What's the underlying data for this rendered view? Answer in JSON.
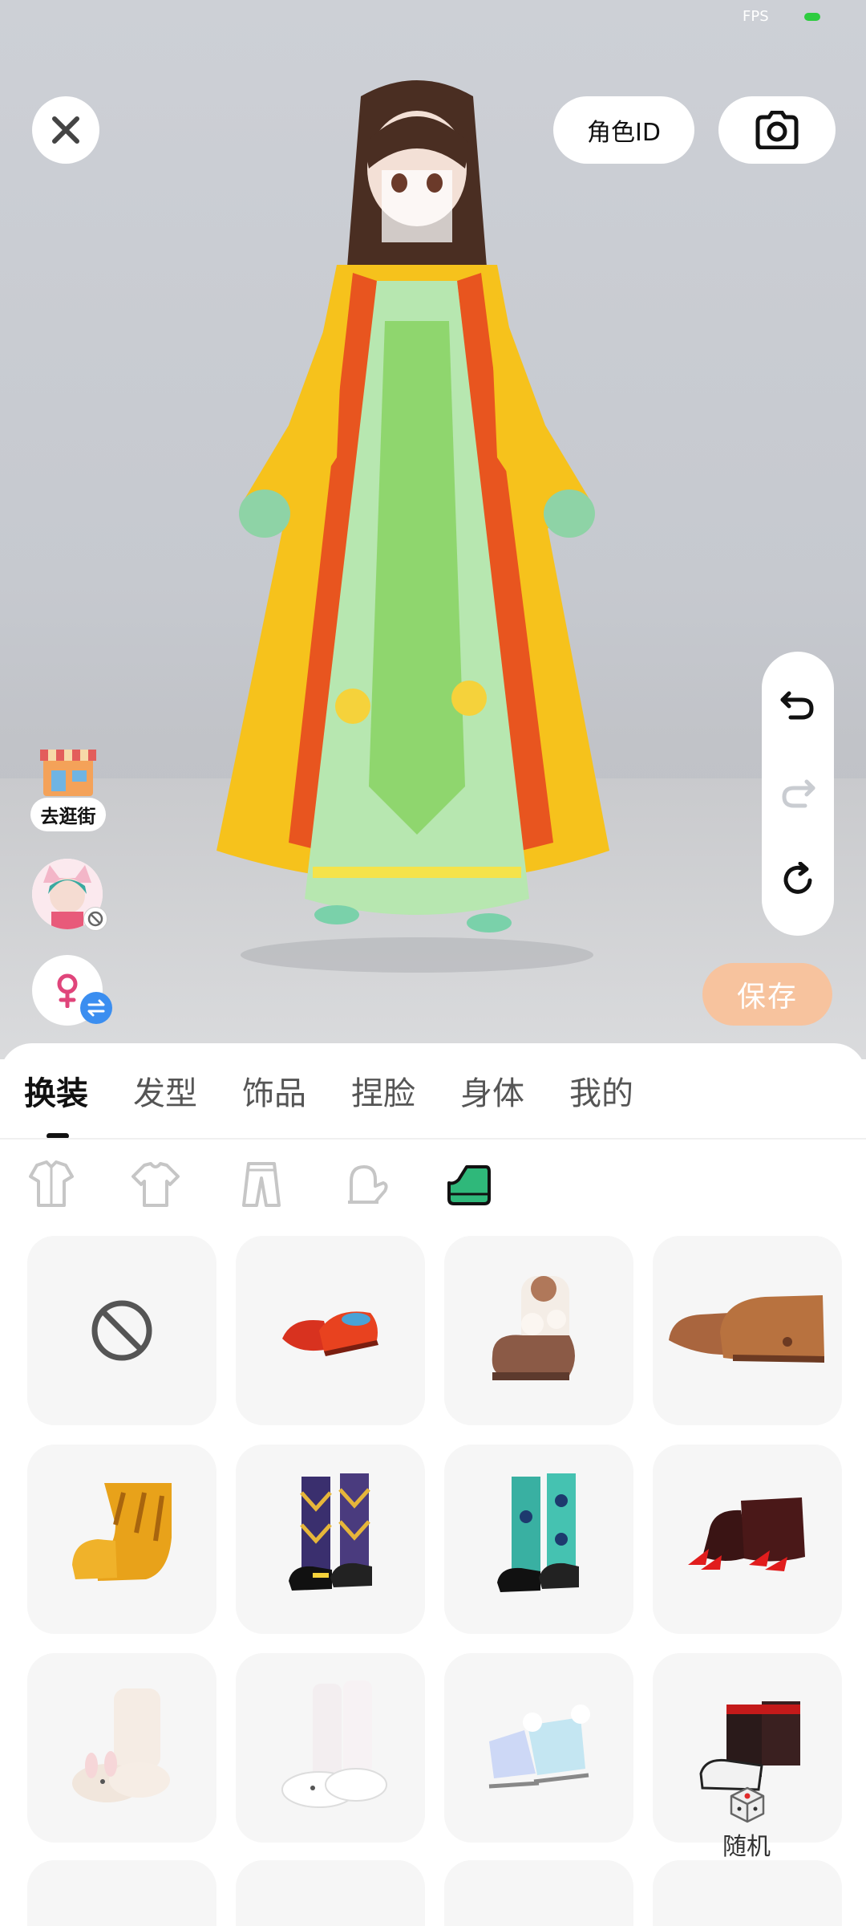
{
  "status": {
    "fps_label": "FPS"
  },
  "topbar": {
    "role_id_label": "角色ID"
  },
  "side": {
    "shop_label": "去逛街"
  },
  "actions": {
    "save_label": "保存"
  },
  "tabs": [
    {
      "label": "换装",
      "active": true
    },
    {
      "label": "发型",
      "active": false
    },
    {
      "label": "饰品",
      "active": false
    },
    {
      "label": "捏脸",
      "active": false
    },
    {
      "label": "身体",
      "active": false
    },
    {
      "label": "我的",
      "active": false
    }
  ],
  "subcategories": [
    "outfit-icon",
    "top-icon",
    "pants-icon",
    "glove-icon",
    "shoe-icon"
  ],
  "selected_subcategory": "shoe-icon",
  "items": [
    {
      "name": "none-icon"
    },
    {
      "name": "red-flat-shoes"
    },
    {
      "name": "fluffy-bear-boots"
    },
    {
      "name": "brown-paw-shoes"
    },
    {
      "name": "yellow-claw-boots"
    },
    {
      "name": "argyle-knee-socks-shoes"
    },
    {
      "name": "teal-eye-socks-shoes"
    },
    {
      "name": "red-black-claw-shoes"
    },
    {
      "name": "cream-bunny-slippers"
    },
    {
      "name": "white-bunny-slipper-socks"
    },
    {
      "name": "holographic-ice-skates"
    },
    {
      "name": "black-red-ankle-boots"
    }
  ],
  "random": {
    "label": "随机",
    "icon": "dice-icon"
  },
  "colors": {
    "accent": "#f7c39e",
    "selected_icon": "#2fb87a",
    "sheet_bg": "#ffffff",
    "item_bg": "#f6f6f6"
  }
}
